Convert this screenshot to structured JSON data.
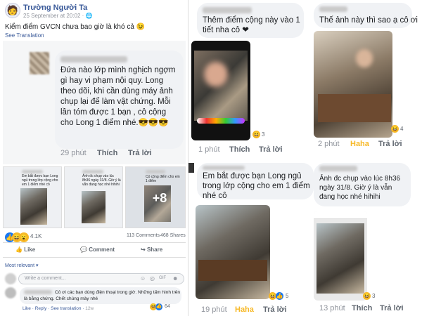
{
  "post": {
    "author": "Trường Người Ta",
    "time": "25 September at 20:02 · ",
    "text": "Kiểm điểm GVCN chưa bao giờ là khó cả 😉",
    "see_translation": "See Translation"
  },
  "main_comment": {
    "text": "Đứa nào lớp mình nghịch ngợm gì hay vi phạm nội quy. Long theo dõi, khi cần dùng máy ảnh chụp lại để làm vật chứng. Mỗi lần tóm được 1 bạn , cô cộng cho Long 1 điểm nhé.😎😎😎",
    "time": "29 phút",
    "like": "Thích",
    "reply": "Trả lời"
  },
  "thumbs": [
    {
      "text": "Em bắt được bạn Long ngủ trong lớp cộng cho em 1 điểm nhé cô"
    },
    {
      "text": "Ảnh đc chụp vào lúc 8h36 ngày 31/8. Giờ ý là vẫn đang học nhé hihihi"
    },
    {
      "text": "Có cộng điểm cho em 1 điểm",
      "more": "+8"
    }
  ],
  "stats": {
    "reactions": "4.1K",
    "comments": "113 Comments",
    "shares": "468 Shares"
  },
  "actions": {
    "like": "Like",
    "comment": "Comment",
    "share": "Share"
  },
  "sort": "Most relevant ▾",
  "input": {
    "placeholder": "Write a comment..."
  },
  "reply_comment": {
    "text": "Cô ơi các bạn dùng điện thoại trong giờ. Những tấm hình trên là bằng chứng. Chết chúng mày nhé",
    "like": "Like",
    "reply": "Reply",
    "see_translation": "See translation",
    "time": "12w",
    "count": "64"
  },
  "c1": {
    "text": "Thêm điểm cộng này vào 1 tiết nha cô ❤",
    "time": "1 phút",
    "like": "Thích",
    "reply": "Trả lời",
    "count": "3"
  },
  "c2": {
    "text": "Thế ảnh này thì sao ạ cô ơi",
    "time": "2 phút",
    "haha": "Haha",
    "reply": "Trả lời",
    "count": "4"
  },
  "c3": {
    "text": "Em bắt được bạn Long ngủ trong lớp cộng cho em 1 điểm nhé cô",
    "time": "19 phút",
    "haha": "Haha",
    "reply": "Trả lời",
    "count": "5"
  },
  "c4": {
    "text": "Ảnh đc chụp vào lúc 8h36 ngày 31/8. Giờ ý là vẫn đang học nhé hihihi",
    "time": "13 phút",
    "like": "Thích",
    "reply": "Trả lời",
    "count": "3"
  }
}
